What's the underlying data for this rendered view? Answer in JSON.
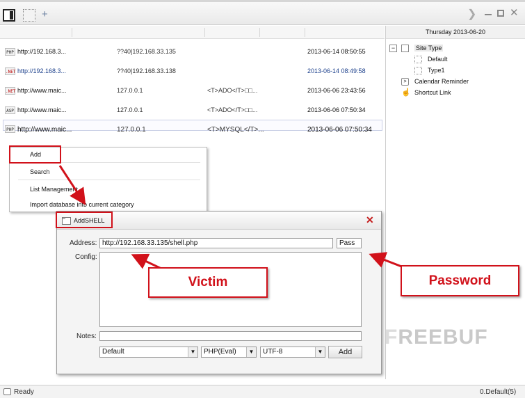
{
  "tabs": {
    "add_symbol": "+"
  },
  "list": {
    "rows": [
      {
        "badge": "PHP",
        "url": "http://192.168.3...",
        "ip": "??40|192.168.33.135",
        "note": "",
        "time": "2013-06-14 08:50:55"
      },
      {
        "badge": ".NET",
        "url": "http://192.168.3...",
        "ip": "??40|192.168.33.138",
        "note": "",
        "time": "2013-06-14 08:49:58"
      },
      {
        "badge": ".NET",
        "url": "http://www.maic...",
        "ip": "127.0.0.1",
        "note": "<T>ADO</T>□□...",
        "time": "2013-06-06 23:43:56"
      },
      {
        "badge": "ASP",
        "url": "http://www.maic...",
        "ip": "127.0.0.1",
        "note": "<T>ADO</T>□□...",
        "time": "2013-06-06 07:50:34"
      },
      {
        "badge": "PHP",
        "url": "http://www.maic...",
        "ip": "127.0.0.1",
        "note": "<T>MYSQL</T>...",
        "time": "2013-06-06 07:50:34"
      }
    ]
  },
  "sidebar": {
    "date": "Thursday  2013-06-20",
    "tree": {
      "expander": "−",
      "root": "Site Type",
      "children": [
        "Default",
        "Type1"
      ],
      "calendar": "Calendar Reminder",
      "shortcut": "Shortcut Link"
    }
  },
  "context_menu": {
    "items": [
      "Add",
      "Search",
      "List Management",
      "Import database into current category"
    ]
  },
  "dialog": {
    "title": "AddSHELL",
    "address_label": "Address:",
    "address_value": "http://192.168.33.135/shell.php",
    "pass_value": "Pass",
    "config_label": "Config:",
    "notes_label": "Notes:",
    "category_value": "Default",
    "type_value": "PHP(Eval)",
    "encoding_value": "UTF-8",
    "add_label": "Add",
    "close_symbol": "✕"
  },
  "annotations": {
    "victim": "Victim",
    "password": "Password",
    "color": "#d1111a"
  },
  "status": {
    "left": "Ready",
    "right": "0.Default(5)"
  },
  "watermark": {
    "first": "F",
    "rest": "REEBUF"
  },
  "icons": [
    "toggle-panel-icon",
    "dotted-tab-icon",
    "chevron-right-icon",
    "minimize-icon",
    "maximize-icon",
    "close-icon",
    "calendar-icon",
    "hand-pointer-icon"
  ]
}
